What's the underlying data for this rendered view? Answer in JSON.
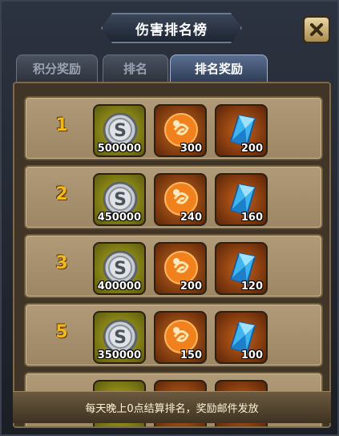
{
  "header": {
    "title": "伤害排名榜"
  },
  "tabs": [
    {
      "label": "积分奖励",
      "active": false
    },
    {
      "label": "排名",
      "active": false
    },
    {
      "label": "排名奖励",
      "active": true
    }
  ],
  "rewards": [
    {
      "rank": "1",
      "items": [
        {
          "icon": "silver-coin-icon",
          "qty": "500000"
        },
        {
          "icon": "fire-orb-icon",
          "qty": "300"
        },
        {
          "icon": "blue-crystal-icon",
          "qty": "200"
        }
      ]
    },
    {
      "rank": "2",
      "items": [
        {
          "icon": "silver-coin-icon",
          "qty": "450000"
        },
        {
          "icon": "fire-orb-icon",
          "qty": "240"
        },
        {
          "icon": "blue-crystal-icon",
          "qty": "160"
        }
      ]
    },
    {
      "rank": "3",
      "items": [
        {
          "icon": "silver-coin-icon",
          "qty": "400000"
        },
        {
          "icon": "fire-orb-icon",
          "qty": "200"
        },
        {
          "icon": "blue-crystal-icon",
          "qty": "120"
        }
      ]
    },
    {
      "rank": "5",
      "items": [
        {
          "icon": "silver-coin-icon",
          "qty": "350000"
        },
        {
          "icon": "fire-orb-icon",
          "qty": "150"
        },
        {
          "icon": "blue-crystal-icon",
          "qty": "100"
        }
      ]
    }
  ],
  "footer": {
    "text": "每天晚上0点结算排名，奖励邮件发放"
  },
  "colors": {
    "rank_gold": "#f2b71c",
    "row_bg": "#b09a78",
    "active_tab": "#5a6f90"
  }
}
